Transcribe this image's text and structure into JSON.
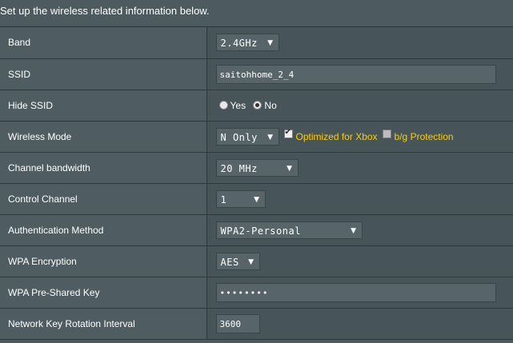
{
  "intro": "Set up the wireless related information below.",
  "rows": {
    "band": {
      "label": "Band",
      "value": "2.4GHz"
    },
    "ssid": {
      "label": "SSID",
      "value": "saitohhome_2_4"
    },
    "hide_ssid": {
      "label": "Hide SSID",
      "yes": "Yes",
      "no": "No",
      "selected": "No"
    },
    "wireless_mode": {
      "label": "Wireless Mode",
      "value": "N Only",
      "xbox_label": "Optimized for Xbox",
      "xbox_checked": true,
      "bg_label": "b/g Protection",
      "bg_checked": false
    },
    "channel_bandwidth": {
      "label": "Channel bandwidth",
      "value": "20 MHz"
    },
    "control_channel": {
      "label": "Control Channel",
      "value": "1"
    },
    "auth_method": {
      "label": "Authentication Method",
      "value": "WPA2-Personal"
    },
    "wpa_encryption": {
      "label": "WPA Encryption",
      "value": "AES"
    },
    "wpa_key": {
      "label": "WPA Pre-Shared Key",
      "value": "••••••••"
    },
    "key_rotation": {
      "label": "Network Key Rotation Interval",
      "value": "3600"
    }
  },
  "colors": {
    "accent_text": "#ffcc00",
    "background": "#4d5a5f"
  }
}
